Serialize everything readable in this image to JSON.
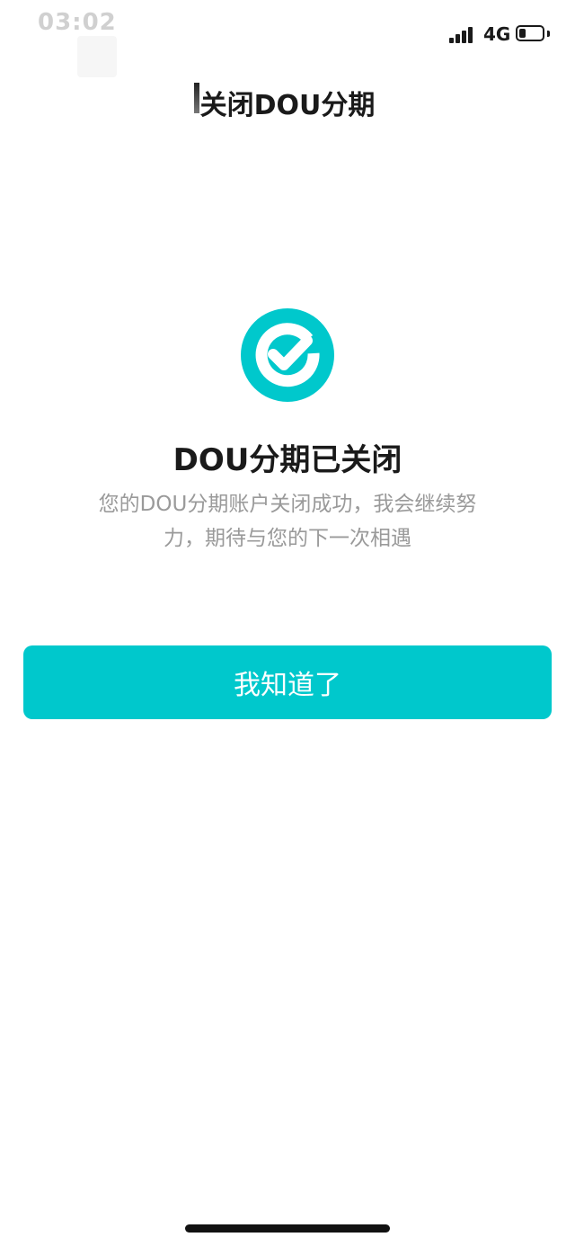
{
  "status_bar": {
    "time": "03:02",
    "network": "4G"
  },
  "nav": {
    "title": "关闭DOU分期"
  },
  "result": {
    "icon": "check-circle-icon",
    "title": "DOU分期已关闭",
    "description": "您的DOU分期账户关闭成功，我会继续努力，期待与您的下一次相遇"
  },
  "actions": {
    "confirm_label": "我知道了"
  },
  "colors": {
    "accent": "#00c8cc",
    "title_text": "#1a1a1a",
    "secondary_text": "#9a9a9a",
    "background": "#ffffff"
  }
}
